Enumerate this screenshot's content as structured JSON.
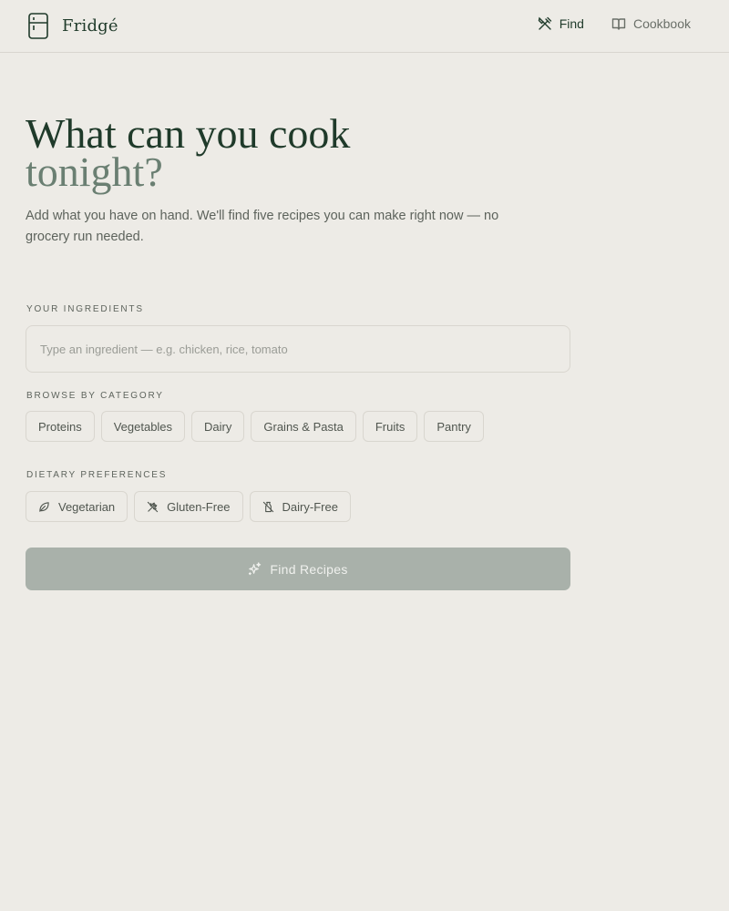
{
  "header": {
    "brand_name": "Fridgé",
    "brand_icon": "fridge-icon",
    "nav": [
      {
        "label": "Find",
        "icon": "utensils-icon",
        "active": true
      },
      {
        "label": "Cookbook",
        "icon": "book-icon",
        "active": false
      }
    ]
  },
  "hero": {
    "title_line1": "What can you cook",
    "title_line2": "tonight?",
    "subtitle": "Add what you have on hand. We'll find five recipes you can make right now — no grocery run needed."
  },
  "ingredients": {
    "label": "YOUR INGREDIENTS",
    "value": "",
    "placeholder": "Type an ingredient — e.g. chicken, rice, tomato"
  },
  "categories": {
    "label": "BROWSE BY CATEGORY",
    "items": [
      "Proteins",
      "Vegetables",
      "Dairy",
      "Grains & Pasta",
      "Fruits",
      "Pantry"
    ]
  },
  "dietary": {
    "label": "DIETARY PREFERENCES",
    "items": [
      {
        "label": "Vegetarian",
        "icon": "leaf-icon"
      },
      {
        "label": "Gluten-Free",
        "icon": "wheat-off-icon"
      },
      {
        "label": "Dairy-Free",
        "icon": "milk-off-icon"
      }
    ]
  },
  "find_button": {
    "label": "Find Recipes",
    "icon": "sparkles-icon"
  },
  "colors": {
    "background": "#edebe6",
    "primary_text": "#1f3a2a",
    "muted_title": "#6a7f72",
    "button_disabled": "#a9b1aa",
    "border": "#d9d6cf"
  }
}
